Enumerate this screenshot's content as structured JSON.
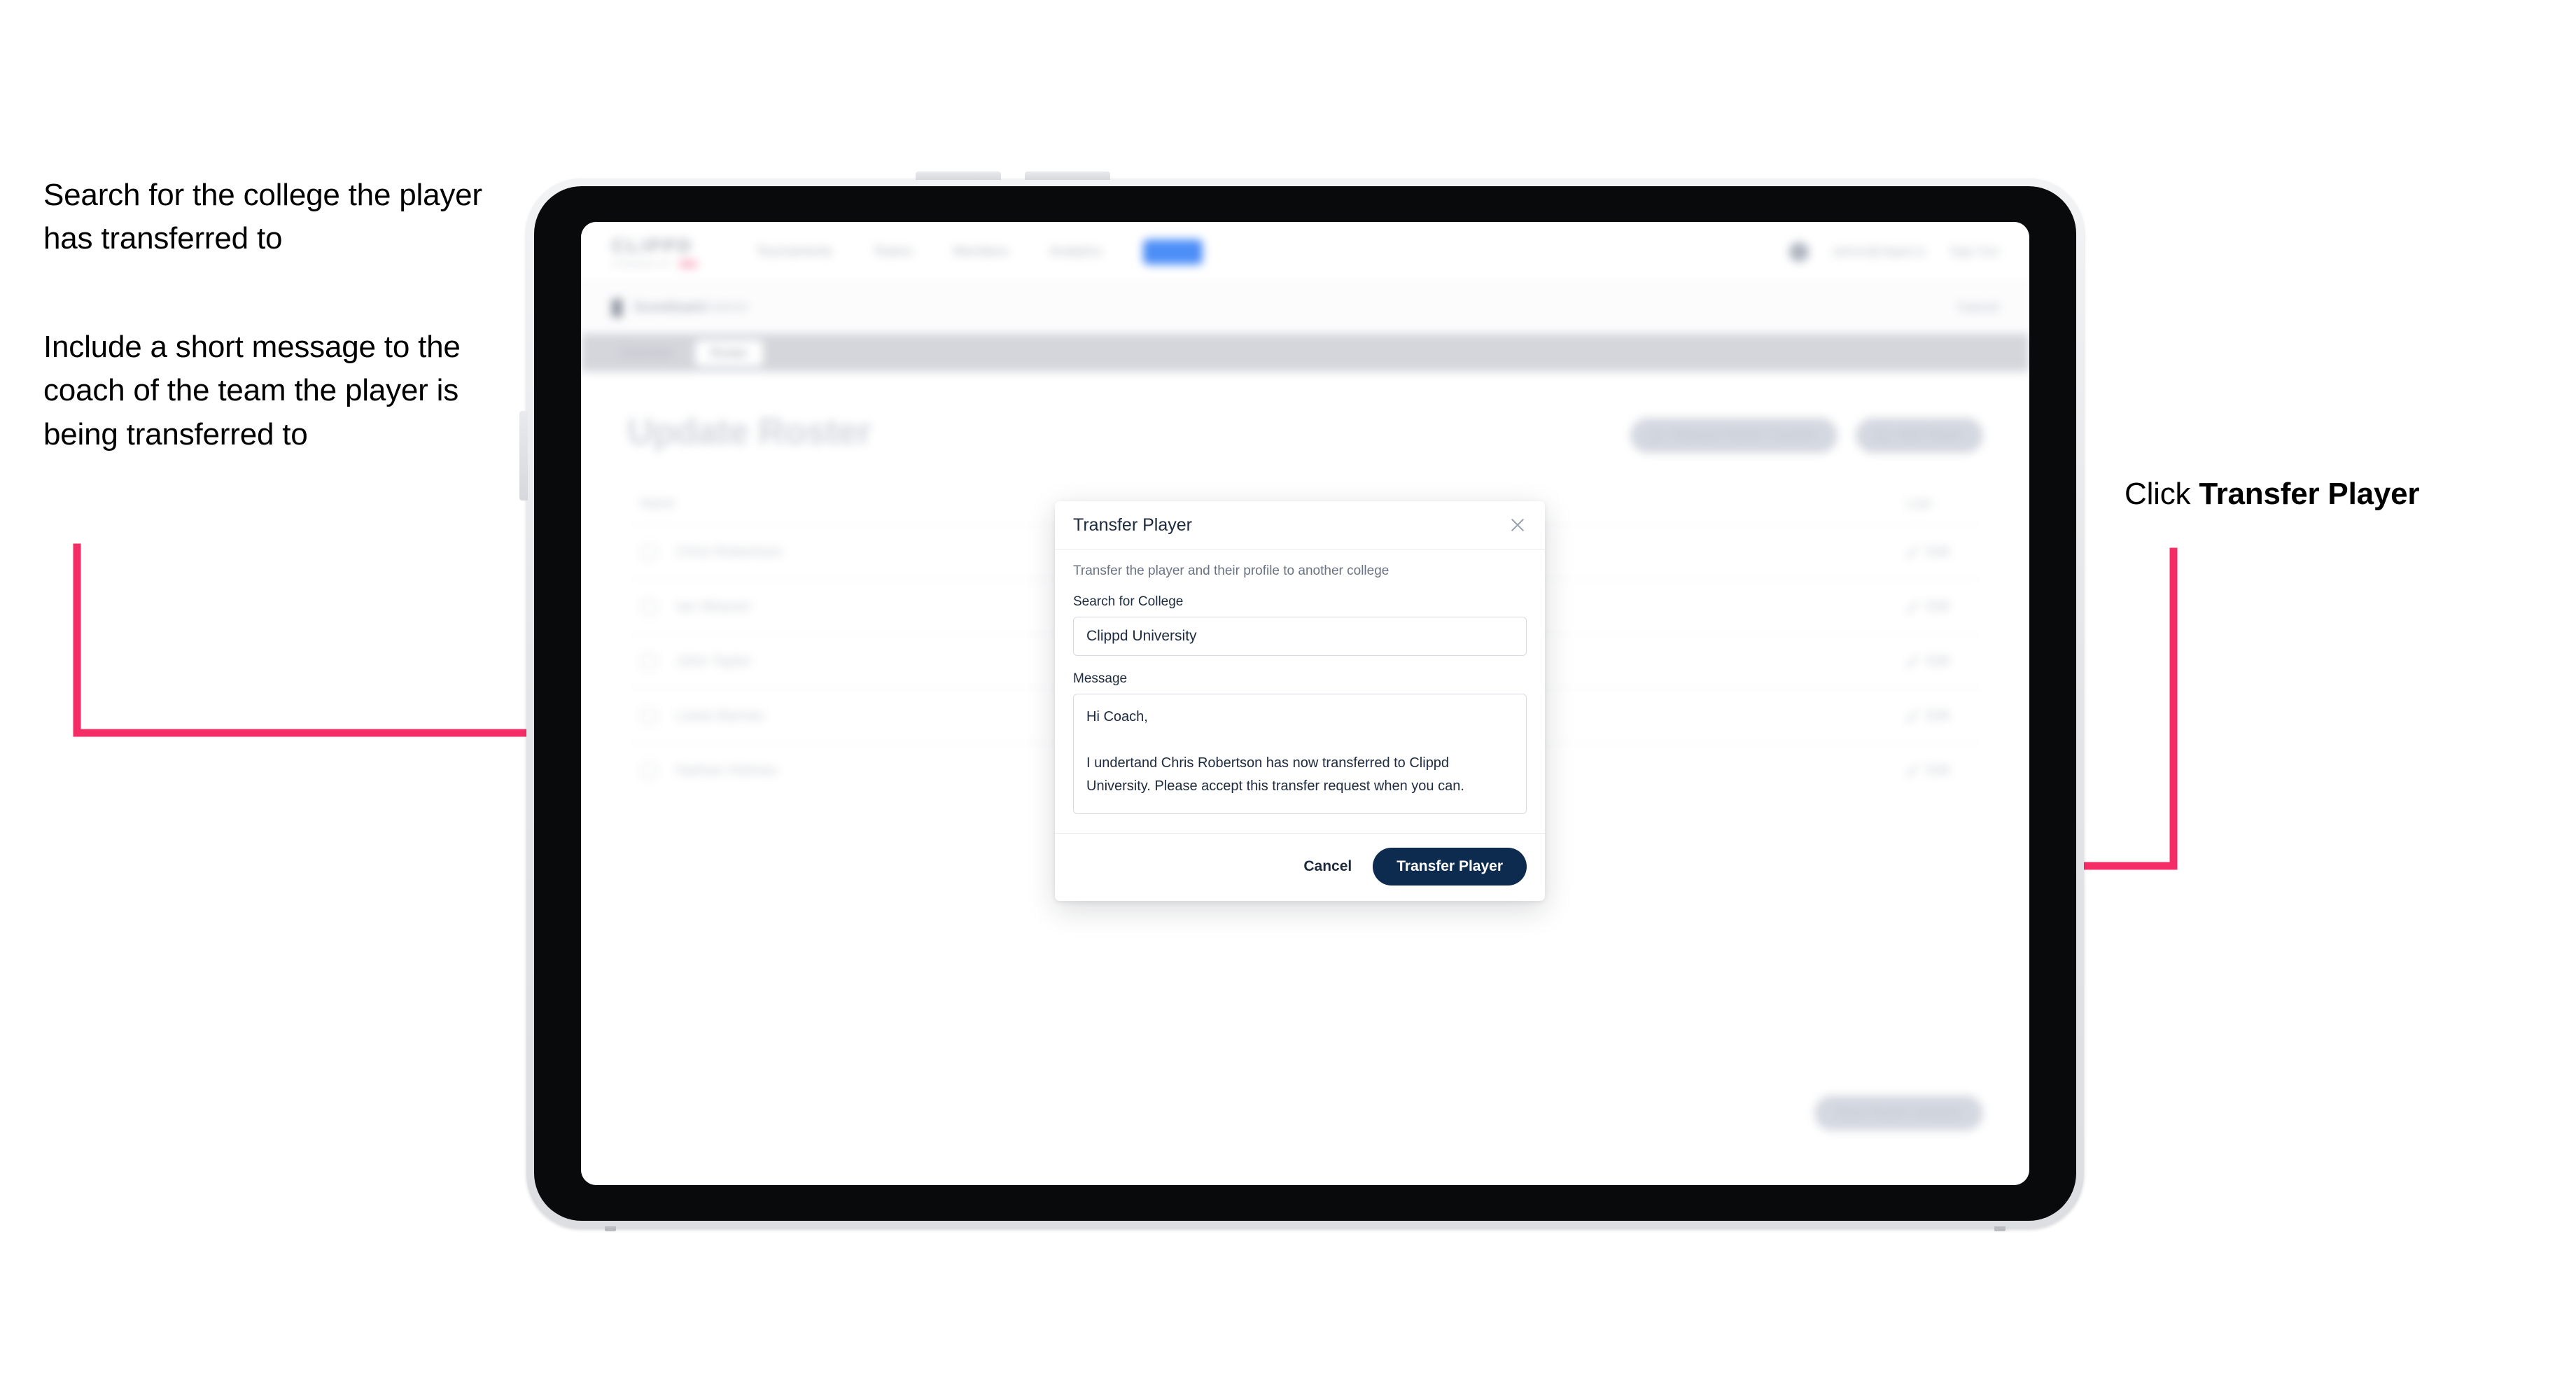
{
  "annotations": {
    "left_1": "Search for the college the player has transferred to",
    "left_2": "Include a short message to the coach of the team the player is being transferred to",
    "right_prefix": "Click ",
    "right_bold": "Transfer Player"
  },
  "colors": {
    "arrow": "#F52D66",
    "primary_button": "#0d2a4f",
    "nav_pill": "#4d8ef7",
    "brand_accent": "#f9b9cb",
    "modal_title": "#1e2a3e"
  },
  "app": {
    "brand": {
      "word": "CLIPPD",
      "sub": "POWERED BY",
      "badge": ""
    },
    "nav_links": [
      {
        "label": "Tournaments",
        "style": "plain"
      },
      {
        "label": "Teams",
        "style": "plain"
      },
      {
        "label": "Members",
        "style": "plain"
      },
      {
        "label": "Analytics",
        "style": "plain"
      },
      {
        "label": "Admin",
        "style": "pill"
      }
    ],
    "nav_right": {
      "account": "admin@clippd.io",
      "sign_out": "Sign Out"
    },
    "breadcrumb": {
      "text": "Scoreboard",
      "muted": "Admin",
      "right": "Cancel"
    },
    "tabs": [
      {
        "label": "Overview",
        "active": false
      },
      {
        "label": "Roster",
        "active": true
      }
    ],
    "page_title": "Update Roster",
    "page_actions": [
      {
        "label": "Request Roster Transfer",
        "icon": "arrow-swap-icon"
      },
      {
        "label": "Add Player",
        "icon": "plus-icon"
      }
    ],
    "roster": {
      "columns": {
        "name": "Name",
        "last": "Last"
      },
      "rows": [
        {
          "name": "Chris Robertson",
          "action": "Edit"
        },
        {
          "name": "Ian Weaver",
          "action": "Edit"
        },
        {
          "name": "John Taylor",
          "action": "Edit"
        },
        {
          "name": "Lewis Barnes",
          "action": "Edit"
        },
        {
          "name": "Nathan Holmes",
          "action": "Edit"
        }
      ],
      "footer_button": "Save Roster Updates"
    }
  },
  "modal": {
    "title": "Transfer Player",
    "close_icon": "close-icon",
    "description": "Transfer the player and their profile to another college",
    "college": {
      "label": "Search for College",
      "value": "Clippd University",
      "placeholder": "Search for College"
    },
    "message": {
      "label": "Message",
      "value": "Hi Coach,\n\nI undertand Chris Robertson has now transferred to Clippd University. Please accept this transfer request when you can.",
      "placeholder": "Write a message"
    },
    "cancel_label": "Cancel",
    "submit_label": "Transfer Player"
  }
}
